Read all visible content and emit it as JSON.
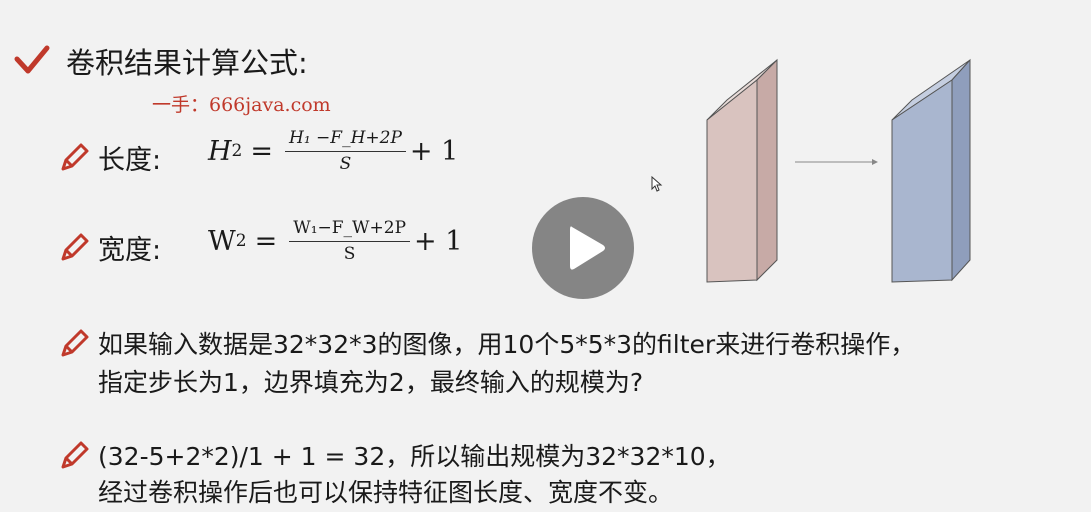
{
  "slide": {
    "title": "卷积结果计算公式:",
    "watermark": "一手：666java.com",
    "height_formula": {
      "label": "长度:",
      "lhs_var": "H",
      "lhs_sub": "2",
      "equals": "=",
      "numerator": "H₁ −F_H+2P",
      "denominator": "S",
      "plus_one": "+ 1"
    },
    "width_formula": {
      "label": "宽度:",
      "lhs_var": "W",
      "lhs_sub": "2",
      "equals": "=",
      "numerator": "W₁−F_W+2P",
      "denominator": "S",
      "plus_one": "+ 1"
    },
    "question_line1": "如果输入数据是32*32*3的图像，用10个5*5*3的filter来进行卷积操作，",
    "question_line2": "指定步长为1，边界填充为2，最终输入的规模为?",
    "answer_line1": "(32-5+2*2)/1 + 1 = 32，所以输出规模为32*32*10，",
    "answer_line2": "经过卷积操作后也可以保持特征图长度、宽度不变。"
  },
  "icons": {
    "title_icon": "check-icon",
    "bullet_icon": "pencil-icon",
    "play": "play-icon",
    "cursor": "cursor-icon"
  },
  "colors": {
    "accent": "#c0392b",
    "input_block": "#d9c3bf",
    "output_block": "#a9b6cf"
  }
}
